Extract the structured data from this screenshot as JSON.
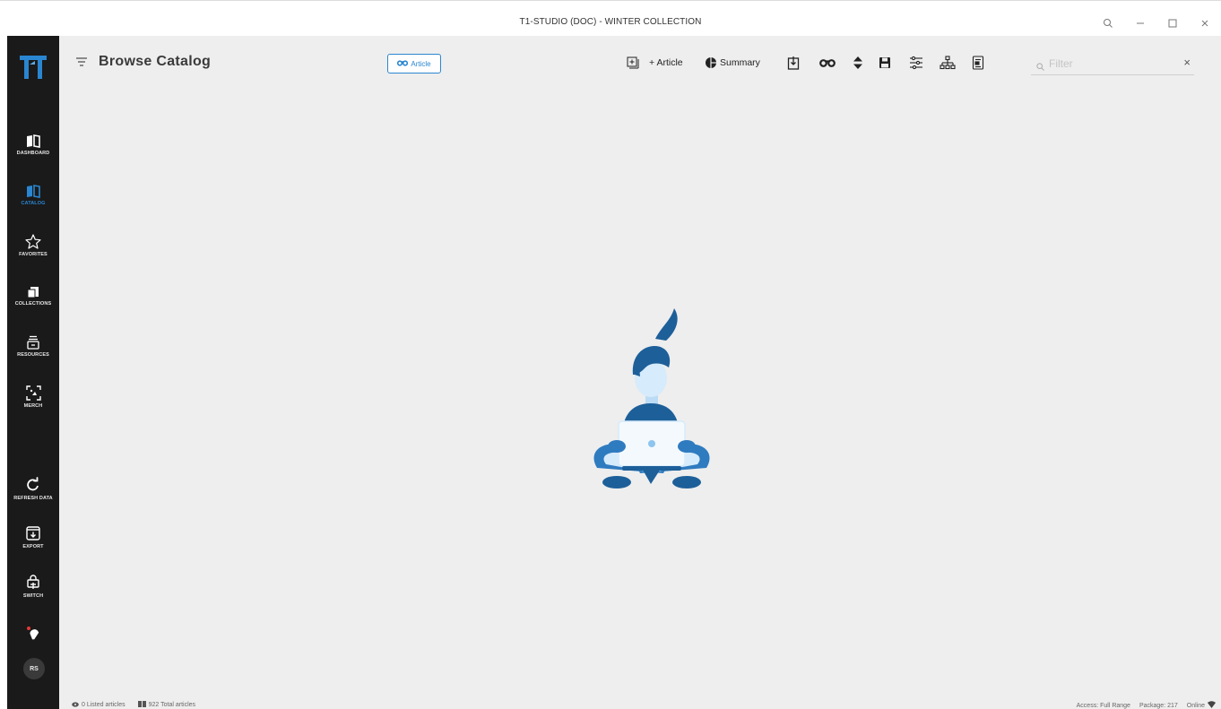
{
  "window": {
    "title": "T1-STUDIO (DOC) - WINTER COLLECTION",
    "controls": [
      "zoom-icon",
      "minimize-icon",
      "maximize-icon",
      "close-icon"
    ]
  },
  "sidebar": {
    "items": [
      {
        "label": "DASHBOARD",
        "icon": "book-open-icon",
        "active": false
      },
      {
        "label": "CATALOG",
        "icon": "book-open-icon",
        "active": true
      },
      {
        "label": "FAVORITES",
        "icon": "star-icon",
        "active": false
      },
      {
        "label": "COLLECTIONS",
        "icon": "folders-icon",
        "active": false
      },
      {
        "label": "RESOURCES",
        "icon": "inbox-tray-icon",
        "active": false
      },
      {
        "label": "MERCH",
        "icon": "focus-frame-icon",
        "active": false
      },
      {
        "label": "REFRESH DATA",
        "icon": "refresh-icon",
        "active": false
      },
      {
        "label": "EXPORT",
        "icon": "export-box-icon",
        "active": false
      },
      {
        "label": "SWITCH",
        "icon": "switch-icon",
        "active": false
      }
    ],
    "avatar_initials": "RS"
  },
  "header": {
    "title": "Browse Catalog",
    "view_toggle_label": "Article"
  },
  "toolbar": {
    "add_article_label": "+ Article",
    "summary_label": "Summary",
    "filter_placeholder": "Filter",
    "filter_value": "",
    "clear_label": "×"
  },
  "statusbar": {
    "listed_articles": "0 Listed articles",
    "total_articles": "922 Total articles",
    "access": "Access: Full Range",
    "package": "Package: 217",
    "online": "Online"
  },
  "colors": {
    "accent": "#2a86d1",
    "sidebar_bg": "#1a1a1a",
    "main_bg": "#eeeeee"
  }
}
